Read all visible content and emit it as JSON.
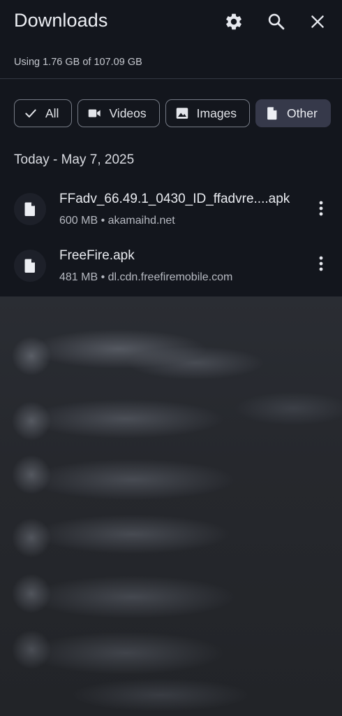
{
  "header": {
    "title": "Downloads",
    "settings_icon": "gear-icon",
    "search_icon": "search-icon",
    "close_icon": "close-icon"
  },
  "storage": {
    "text": "Using 1.76 GB of 107.09 GB"
  },
  "filters": {
    "chips": [
      {
        "label": "All",
        "icon": "check-icon",
        "selected": false
      },
      {
        "label": "Videos",
        "icon": "video-camera-icon",
        "selected": false
      },
      {
        "label": "Images",
        "icon": "image-icon",
        "selected": false
      },
      {
        "label": "Other",
        "icon": "document-icon",
        "selected": true
      }
    ]
  },
  "section": {
    "label": "Today - May 7, 2025"
  },
  "items": [
    {
      "name": "FFadv_66.49.1_0430_ID_ffadvre....apk",
      "meta": "600 MB • akamaihd.net",
      "icon": "file-icon",
      "more_icon": "more-vertical-icon"
    },
    {
      "name": "FreeFire.apk",
      "meta": "481 MB • dl.cdn.freefiremobile.com",
      "icon": "file-icon",
      "more_icon": "more-vertical-icon"
    }
  ],
  "colors": {
    "background": "#13161d",
    "selected_chip": "#36394a",
    "chip_border": "#767b86"
  }
}
